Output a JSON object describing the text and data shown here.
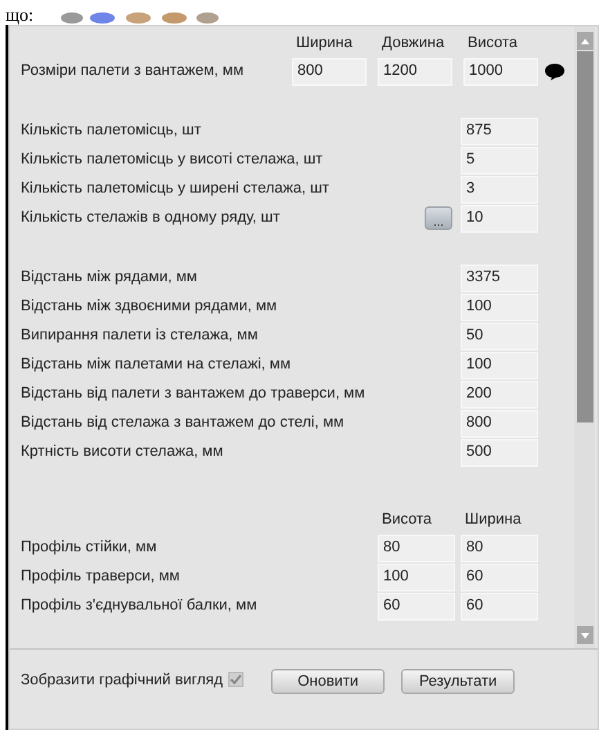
{
  "top_text": "що:",
  "size_row": {
    "label": "Розміри палети з вантажем, мм",
    "headers": [
      "Ширина",
      "Довжина",
      "Висота"
    ],
    "values": [
      "800",
      "1200",
      "1000"
    ]
  },
  "groups": [
    {
      "rows": [
        {
          "label": "Кількість палетомісць, шт",
          "value": "875"
        },
        {
          "label": "Кількість палетомісць у висоті стелажа, шт",
          "value": "5"
        },
        {
          "label": "Кількість палетомісць у ширені стелажа, шт",
          "value": "3"
        },
        {
          "label": "Кількість стелажів в одному ряду, шт",
          "value": "10",
          "button": "..."
        }
      ]
    },
    {
      "rows": [
        {
          "label": "Відстань між рядами, мм",
          "value": "3375"
        },
        {
          "label": "Відстань між здвоєними рядами, мм",
          "value": "100"
        },
        {
          "label": "Випирання палети із стелажа, мм",
          "value": "50"
        },
        {
          "label": "Відстань між палетами на стелажі, мм",
          "value": "100"
        },
        {
          "label": "Відстань від палети з вантажем до траверси, мм",
          "value": "200"
        },
        {
          "label": "Відстань від стелажа з вантажем до стелі, мм",
          "value": "800"
        },
        {
          "label": "Кртність висоти стелажа, мм",
          "value": "500"
        }
      ]
    }
  ],
  "profile": {
    "headers": [
      "Висота",
      "Ширина"
    ],
    "rows": [
      {
        "label": "Профіль стійки, мм",
        "values": [
          "80",
          "80"
        ]
      },
      {
        "label": "Профіль траверси, мм",
        "values": [
          "100",
          "60"
        ]
      },
      {
        "label": "Профіль з'єднувальної балки, мм",
        "values": [
          "60",
          "60"
        ]
      }
    ]
  },
  "footer": {
    "checkbox": {
      "label": "Зобразити графічний вигляд",
      "checked": true
    },
    "buttons": [
      "Оновити",
      "Результати"
    ]
  }
}
